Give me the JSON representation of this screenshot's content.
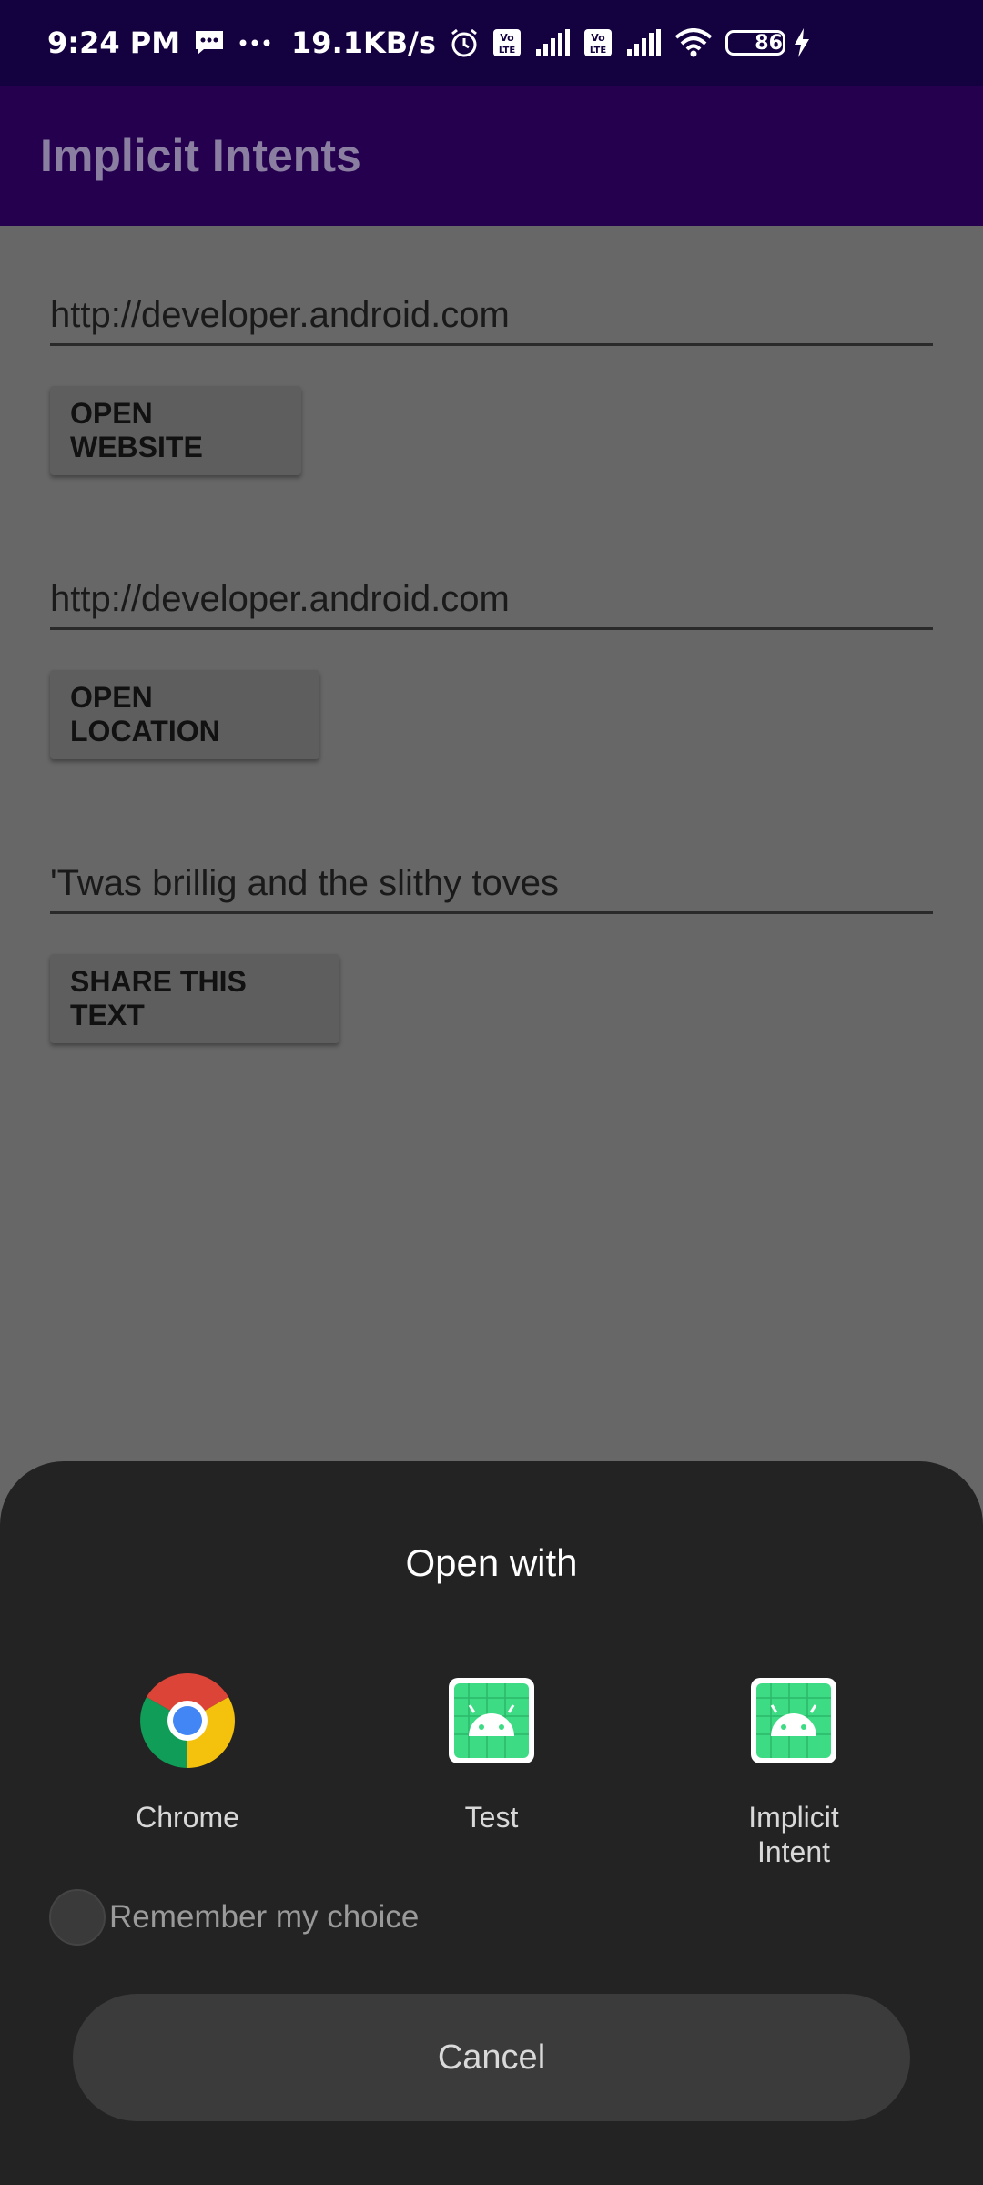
{
  "status_bar": {
    "time": "9:24 PM",
    "speed": "19.1KB/s",
    "battery": "86",
    "icons": [
      "message-icon",
      "more-dots-icon",
      "alarm-icon",
      "volte-icon",
      "signal-icon",
      "volte-icon",
      "signal-icon",
      "wifi-icon",
      "battery-icon",
      "charging-icon"
    ]
  },
  "app_bar": {
    "title": "Implicit Intents"
  },
  "content": {
    "website_field": "http://developer.android.com",
    "open_website": "OPEN WEBSITE",
    "location_field": "http://developer.android.com",
    "open_location": "OPEN LOCATION",
    "share_field": "'Twas brillig and the slithy toves",
    "share_text": "SHARE THIS TEXT"
  },
  "sheet": {
    "title": "Open with",
    "apps": [
      {
        "label": "Chrome",
        "icon": "chrome-icon"
      },
      {
        "label": "Test",
        "icon": "android-icon"
      },
      {
        "label": "Implicit Intent",
        "icon": "android-icon"
      }
    ],
    "remember_label": "Remember my choice",
    "cancel_label": "Cancel"
  }
}
